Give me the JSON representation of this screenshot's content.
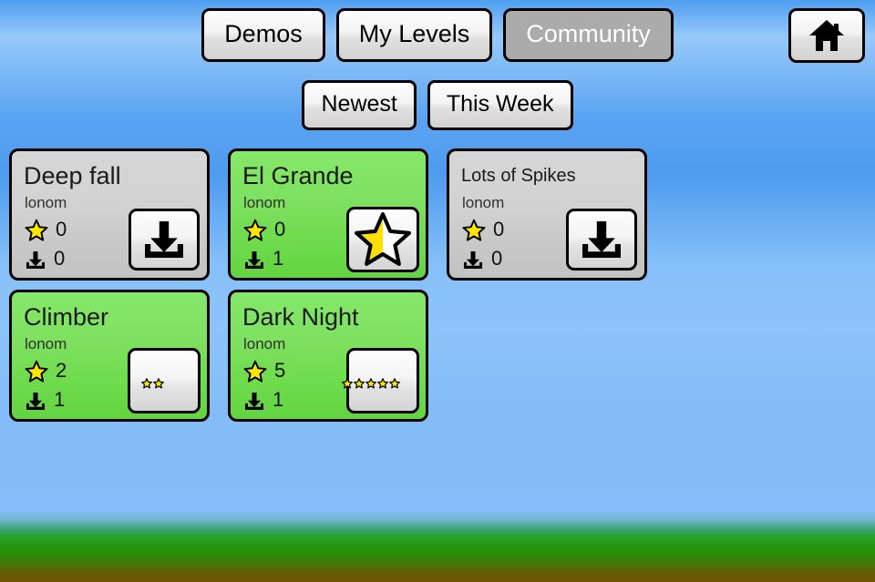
{
  "app": {
    "background": {
      "sky_color": "#6fb2f5",
      "grass_color": "#239600",
      "dirt_color": "#765404"
    }
  },
  "tabs": {
    "items": [
      {
        "id": "demos",
        "label": "Demos",
        "active": false
      },
      {
        "id": "my-levels",
        "label": "My Levels",
        "active": false
      },
      {
        "id": "community",
        "label": "Community",
        "active": true
      }
    ],
    "active_tab_bg": "#ababab",
    "active_tab_fg": "#ffffff"
  },
  "home_button": {
    "icon": "home-icon",
    "label": "Home"
  },
  "filters": {
    "items": [
      {
        "id": "newest",
        "label": "Newest"
      },
      {
        "id": "this-week",
        "label": "This Week"
      }
    ]
  },
  "levels": [
    {
      "title": "Deep fall",
      "author": "lonom",
      "rating": "0",
      "downloads": "0",
      "downloaded": false,
      "action": "download",
      "title_shrunk": false,
      "stars_filled": 0
    },
    {
      "title": "El Grande",
      "author": "lonom",
      "rating": "0",
      "downloads": "1",
      "downloaded": true,
      "action": "rate-half-star",
      "title_shrunk": false,
      "stars_filled": 0
    },
    {
      "title": "Lots of Spikes",
      "author": "lonom",
      "rating": "0",
      "downloads": "0",
      "downloaded": false,
      "action": "download",
      "title_shrunk": true,
      "stars_filled": 0
    },
    {
      "title": "Climber",
      "author": "lonom",
      "rating": "2",
      "downloads": "1",
      "downloaded": true,
      "action": "rate-stars",
      "title_shrunk": false,
      "stars_filled": 2
    },
    {
      "title": "Dark Night",
      "author": "lonom",
      "rating": "5",
      "downloads": "1",
      "downloaded": true,
      "action": "rate-stars",
      "title_shrunk": false,
      "stars_filled": 5
    }
  ],
  "icons": {
    "star": "star-icon",
    "download": "download-icon",
    "home": "home-icon"
  },
  "colors": {
    "star_fill": "#ffe600",
    "card_downloaded": "#79df57",
    "card_undownloaded": "#cfcfcf"
  }
}
